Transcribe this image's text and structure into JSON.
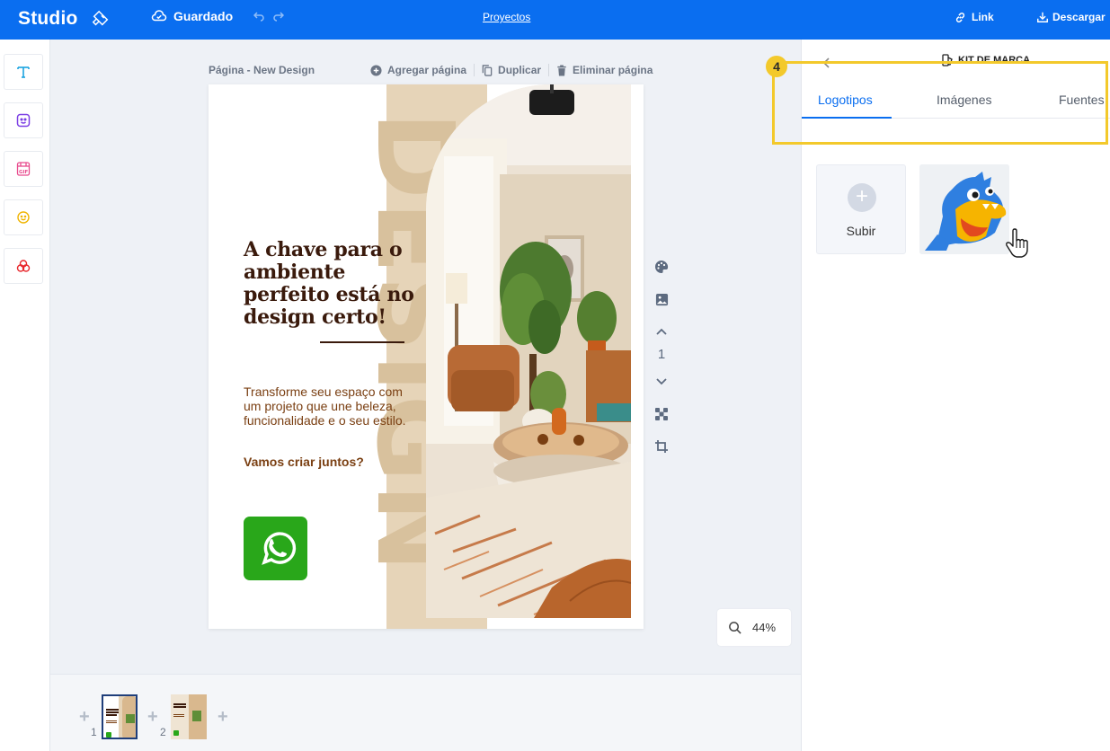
{
  "topbar": {
    "app_name": "Studio",
    "saved_label": "Guardado",
    "projects_label": "Proyectos",
    "link_label": "Link",
    "download_label": "Descargar",
    "accent_color": "#0a6ef0"
  },
  "left_tools": [
    {
      "name": "text-tool",
      "icon": "text-icon"
    },
    {
      "name": "elements-tool",
      "icon": "sticker-icon"
    },
    {
      "name": "gif-tool",
      "icon": "gif-icon"
    },
    {
      "name": "emoji-tool",
      "icon": "smiley-icon"
    },
    {
      "name": "brand-tool",
      "icon": "rings-icon"
    }
  ],
  "canvas": {
    "page_label": "Página - New Design",
    "add_page_label": "Agregar página",
    "duplicate_label": "Duplicar",
    "delete_page_label": "Eliminar página",
    "current_page": "1",
    "zoom_label": "44%"
  },
  "design": {
    "headline": "A chave para o ambiente perfeito está no design certo!",
    "body": "Transforme seu espaço com um projeto que une beleza, funcionalidade e o seu estilo.",
    "cta": "Vamos criar juntos?",
    "background_word": "DESIGN",
    "headline_color": "#3a1a0c",
    "body_color": "#7a3f12"
  },
  "pages_strip": {
    "thumbs": [
      {
        "number": "1",
        "selected": true
      },
      {
        "number": "2",
        "selected": false
      }
    ]
  },
  "right_panel": {
    "title": "KIT DE MARCA",
    "tabs": [
      "Logotipos",
      "Imágenes",
      "Fuentes"
    ],
    "active_tab": "Logotipos",
    "upload_label": "Subir",
    "step_number": "4",
    "highlight_color": "#f3c92b"
  }
}
